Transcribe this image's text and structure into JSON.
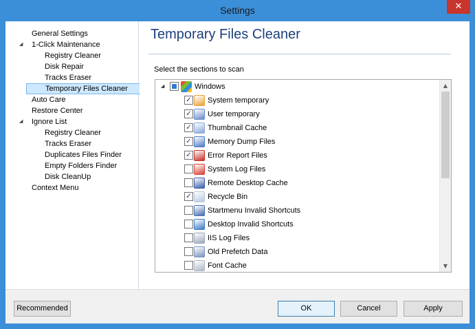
{
  "window": {
    "title": "Settings",
    "close_glyph": "✕"
  },
  "tree": {
    "items": [
      {
        "label": "General Settings",
        "expander": "",
        "selected": false
      },
      {
        "label": "1-Click Maintenance",
        "expander": "◢",
        "selected": false
      },
      {
        "label": "Registry Cleaner",
        "expander": "",
        "selected": false
      },
      {
        "label": "Disk Repair",
        "expander": "",
        "selected": false
      },
      {
        "label": "Tracks Eraser",
        "expander": "",
        "selected": false
      },
      {
        "label": "Temporary Files Cleaner",
        "expander": "",
        "selected": true
      },
      {
        "label": "Auto Care",
        "expander": "",
        "selected": false
      },
      {
        "label": "Restore Center",
        "expander": "",
        "selected": false
      },
      {
        "label": "Ignore List",
        "expander": "◢",
        "selected": false
      },
      {
        "label": "Registry Cleaner",
        "expander": "",
        "selected": false
      },
      {
        "label": "Tracks Eraser",
        "expander": "",
        "selected": false
      },
      {
        "label": "Duplicates Files Finder",
        "expander": "",
        "selected": false
      },
      {
        "label": "Empty Folders Finder",
        "expander": "",
        "selected": false
      },
      {
        "label": "Disk CleanUp",
        "expander": "",
        "selected": false
      },
      {
        "label": "Context Menu",
        "expander": "",
        "selected": false
      }
    ]
  },
  "main": {
    "heading": "Temporary Files Cleaner",
    "hint": "Select the sections to scan",
    "group": {
      "label": "Windows",
      "expander": "◢",
      "state": "partial",
      "icon": "windows-logo-icon"
    },
    "sections": [
      {
        "label": "System temporary",
        "checked": true,
        "icon": "windows-flag-icon",
        "color": "#e9a23b"
      },
      {
        "label": "User temporary",
        "checked": true,
        "icon": "user-temp-icon",
        "color": "#6b8cc7"
      },
      {
        "label": "Thumbnail Cache",
        "checked": true,
        "icon": "thumbnail-cache-icon",
        "color": "#8aa7d8"
      },
      {
        "label": "Memory Dump Files",
        "checked": true,
        "icon": "memory-dump-icon",
        "color": "#4f7bc4"
      },
      {
        "label": "Error Report Files",
        "checked": true,
        "icon": "error-report-icon",
        "color": "#c8302a"
      },
      {
        "label": "System Log Files",
        "checked": false,
        "icon": "system-log-icon",
        "color": "#d9423a"
      },
      {
        "label": "Remote Desktop Cache",
        "checked": false,
        "icon": "remote-desktop-icon",
        "color": "#3a5fa8"
      },
      {
        "label": "Recycle Bin",
        "checked": true,
        "icon": "recycle-bin-icon",
        "color": "#b8c9e0"
      },
      {
        "label": "Startmenu Invalid Shortcuts",
        "checked": false,
        "icon": "startmenu-shortcut-icon",
        "color": "#4a6fb0"
      },
      {
        "label": "Desktop Invalid Shortcuts",
        "checked": false,
        "icon": "desktop-shortcut-icon",
        "color": "#3c7cc8"
      },
      {
        "label": "IIS Log Files",
        "checked": false,
        "icon": "iis-log-icon",
        "color": "#9aa8bb"
      },
      {
        "label": "Old Prefetch Data",
        "checked": false,
        "icon": "prefetch-icon",
        "color": "#7a94bc"
      },
      {
        "label": "Font Cache",
        "checked": false,
        "icon": "font-cache-icon",
        "color": "#b0b8c8"
      }
    ],
    "scroll": {
      "up": "▲",
      "down": "▼"
    },
    "check_glyph": "✓"
  },
  "footer": {
    "recommended": "Recommended",
    "ok": "OK",
    "cancel": "Cancel",
    "apply": "Apply"
  },
  "colors": {
    "titlebar": "#3b8fd9",
    "heading": "#1c3f7c",
    "selection": "#cde8ff",
    "close": "#c7352c"
  }
}
